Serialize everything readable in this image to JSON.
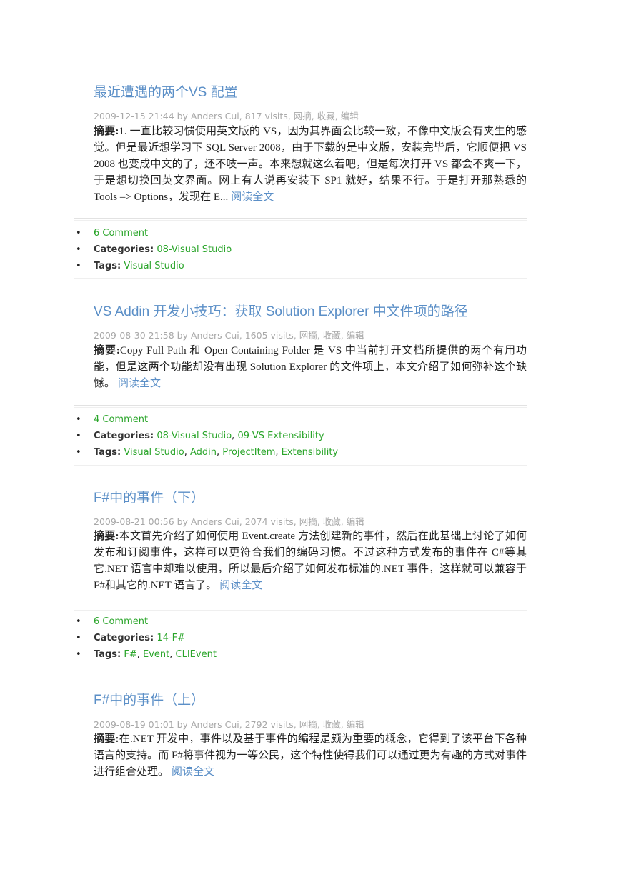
{
  "posts": [
    {
      "title": "最近遭遇的两个VS 配置",
      "meta_prefix": "2009-12-15 21:44 by Anders Cui, 817 visits, ",
      "actions": [
        "网摘",
        "收藏",
        "编辑"
      ],
      "summary_label": "摘要:",
      "summary": "1. 一直比较习惯使用英文版的 VS，因为其界面会比较一致，不像中文版会有夹生的感觉。但是最近想学习下 SQL Server 2008，由于下载的是中文版，安装完毕后，它顺便把 VS 2008 也变成中文的了，还不吱一声。本来想就这么着吧，但是每次打开 VS 都会不爽一下，于是想切换回英文界面。网上有人说再安装下 SP1 就好，结果不行。于是打开那熟悉的 Tools –> Options，发现在 E...",
      "read_more": "阅读全文",
      "comments": "6 Comment",
      "categories_label": "Categories:",
      "categories": [
        "08-Visual Studio"
      ],
      "tags_label": "Tags:",
      "tags": [
        "Visual Studio"
      ]
    },
    {
      "title": "VS Addin 开发小技巧：获取 Solution Explorer 中文件项的路径",
      "meta_prefix": "2009-08-30 21:58 by Anders Cui, 1605 visits, ",
      "actions": [
        "网摘",
        "收藏",
        "编辑"
      ],
      "summary_label": "摘要:",
      "summary": "Copy Full Path 和 Open Containing Folder 是 VS 中当前打开文档所提供的两个有用功能，但是这两个功能却没有出现 Solution Explorer 的文件项上，本文介绍了如何弥补这个缺憾。",
      "read_more": "阅读全文",
      "comments": "4 Comment",
      "categories_label": "Categories:",
      "categories": [
        "08-Visual Studio",
        "09-VS Extensibility"
      ],
      "tags_label": "Tags:",
      "tags": [
        "Visual Studio",
        "Addin",
        "ProjectItem",
        "Extensibility"
      ]
    },
    {
      "title": "F#中的事件（下）",
      "meta_prefix": "2009-08-21 00:56 by Anders Cui, 2074 visits, ",
      "actions": [
        "网摘",
        "收藏",
        "编辑"
      ],
      "summary_label": "摘要:",
      "summary": "本文首先介绍了如何使用 Event.create 方法创建新的事件，然后在此基础上讨论了如何发布和订阅事件，这样可以更符合我们的编码习惯。不过这种方式发布的事件在 C#等其它.NET 语言中却难以使用，所以最后介绍了如何发布标准的.NET 事件，这样就可以兼容于 F#和其它的.NET 语言了。",
      "read_more": "阅读全文",
      "comments": "6 Comment",
      "categories_label": "Categories:",
      "categories": [
        "14-F#"
      ],
      "tags_label": "Tags:",
      "tags": [
        "F#",
        "Event",
        "CLIEvent"
      ]
    },
    {
      "title": "F#中的事件（上）",
      "meta_prefix": "2009-08-19 01:01 by Anders Cui, 2792 visits, ",
      "actions": [
        "网摘",
        "收藏",
        "编辑"
      ],
      "summary_label": "摘要:",
      "summary": "在.NET 开发中，事件以及基于事件的编程是颇为重要的概念，它得到了该平台下各种语言的支持。而 F#将事件视为一等公民，这个特性使得我们可以通过更为有趣的方式对事件进行组合处理。",
      "read_more": "阅读全文"
    }
  ]
}
